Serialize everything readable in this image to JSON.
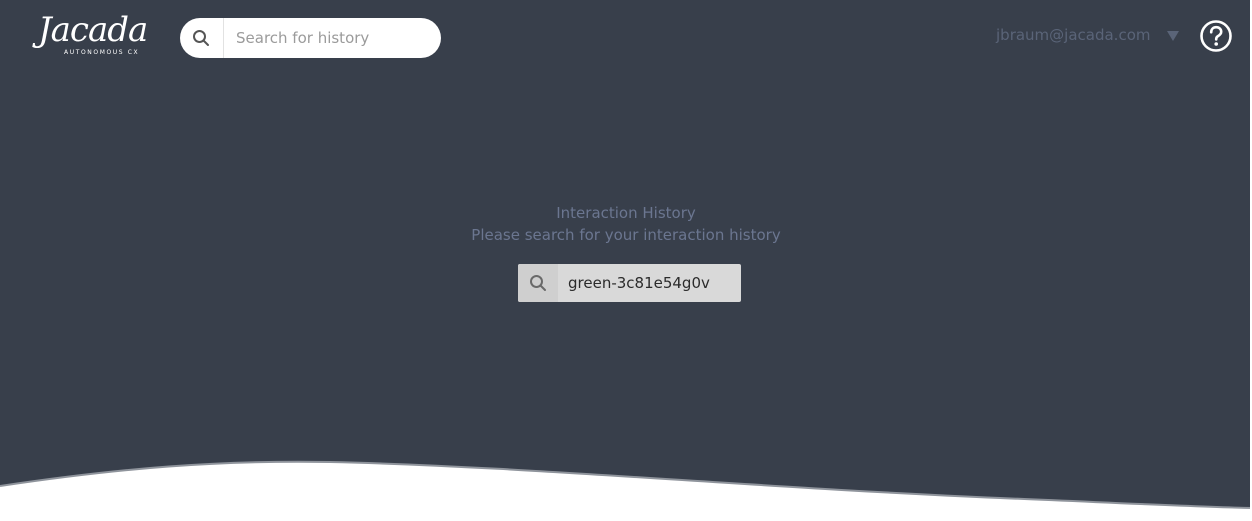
{
  "brand": {
    "logo_text": "Jacada",
    "logo_subtext": "AUTONOMOUS CX"
  },
  "header": {
    "search": {
      "placeholder": "Search for history",
      "value": ""
    },
    "user_email": "jbraum@jacada.com",
    "icons": {
      "search": "search-icon",
      "user_menu": "caret-down-icon",
      "help": "help-circle-icon"
    }
  },
  "main": {
    "title": "Interaction History",
    "subtitle": "Please search for your interaction history",
    "search": {
      "value": "green-3c81e54g0v",
      "icon": "search-icon"
    }
  },
  "colors": {
    "background": "#383f4b",
    "muted_text": "#6b7690",
    "search_field": "#d9d9d9",
    "white": "#ffffff"
  }
}
